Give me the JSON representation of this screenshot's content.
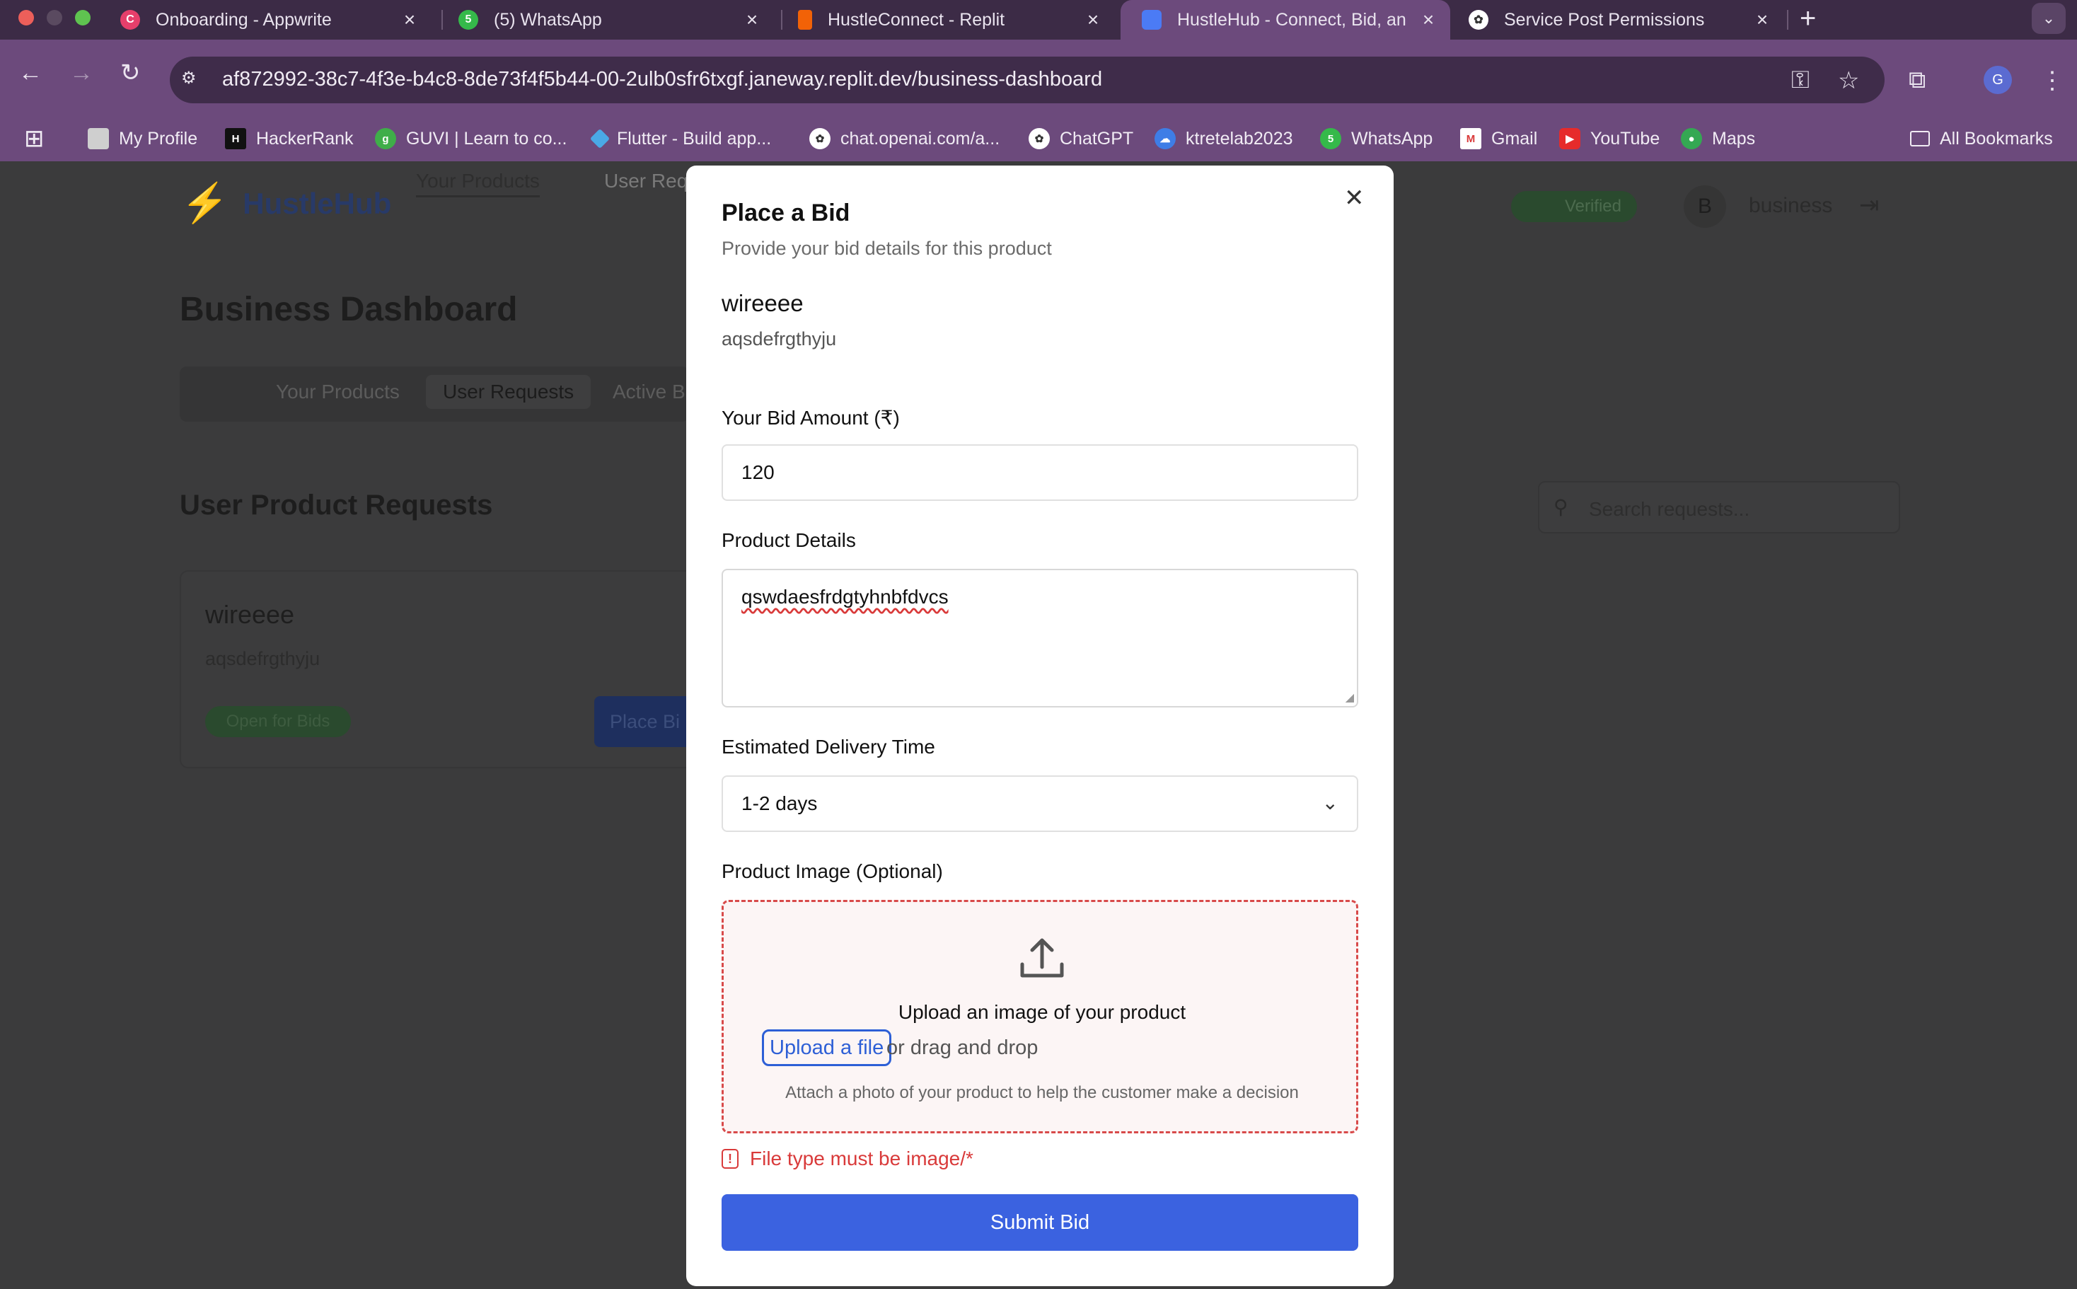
{
  "browser": {
    "tabs": [
      {
        "label": "Onboarding - Appwrite",
        "icon": "appwrite-icon"
      },
      {
        "label": "(5) WhatsApp",
        "icon": "whatsapp-icon"
      },
      {
        "label": "HustleConnect - Replit",
        "icon": "replit-icon"
      },
      {
        "label": "HustleHub - Connect, Bid, an",
        "icon": "hustlehub-icon",
        "active": true
      },
      {
        "label": "Service Post Permissions",
        "icon": "openai-icon"
      }
    ],
    "url_host": "af872992-38c7-4f3e-b4c8-8de73f4f5b44-00-2ulb0sfr6txgf.janeway.replit.dev",
    "url_path": "/business-dashboard",
    "profile_initial": "G",
    "bookmarks": [
      {
        "label": "My Profile",
        "icon": "page-icon"
      },
      {
        "label": "HackerRank",
        "icon": "hackerrank-icon"
      },
      {
        "label": "GUVI | Learn to co...",
        "icon": "guvi-icon"
      },
      {
        "label": "Flutter - Build app...",
        "icon": "flutter-icon"
      },
      {
        "label": "chat.openai.com/a...",
        "icon": "openai-icon"
      },
      {
        "label": "ChatGPT",
        "icon": "openai-icon"
      },
      {
        "label": "ktretelab2023",
        "icon": "cloud-icon"
      },
      {
        "label": "WhatsApp",
        "icon": "whatsapp-icon"
      },
      {
        "label": "Gmail",
        "icon": "gmail-icon"
      },
      {
        "label": "YouTube",
        "icon": "youtube-icon"
      },
      {
        "label": "Maps",
        "icon": "maps-icon"
      }
    ],
    "all_bookmarks": "All Bookmarks"
  },
  "app": {
    "brand": "HustleHub",
    "nav": [
      "Your Products",
      "User Req"
    ],
    "verified": "Verified",
    "avatar_initial": "B",
    "username": "business",
    "page_title": "Business Dashboard",
    "tabs": [
      "Your Products",
      "User Requests",
      "Active B"
    ],
    "section_title": "User Product Requests",
    "search_placeholder": "Search requests...",
    "card": {
      "title": "wireeee",
      "subtitle": "aqsdefrgthyju",
      "badge": "Open for Bids",
      "button": "Place Bi"
    }
  },
  "modal": {
    "title": "Place a Bid",
    "subtitle": "Provide your bid details for this product",
    "product_name": "wireeee",
    "product_desc": "aqsdefrgthyju",
    "bid_label": "Your Bid Amount (₹)",
    "bid_value": "120",
    "details_label": "Product Details",
    "details_value": "qswdaesfrdgtyhnbfdvcs",
    "delivery_label": "Estimated Delivery Time",
    "delivery_value": "1-2 days",
    "image_label": "Product Image (Optional)",
    "upload_title": "Upload an image of your product",
    "upload_link": "Upload a file",
    "upload_drag": "or drag and drop",
    "upload_hint": "Attach a photo of your product to help the customer make a decision",
    "error": "File type must be image/*",
    "submit": "Submit Bid"
  },
  "colors": {
    "accent": "#3b62e0",
    "error": "#d93a3a",
    "browser_frame": "#6c4a7c"
  }
}
